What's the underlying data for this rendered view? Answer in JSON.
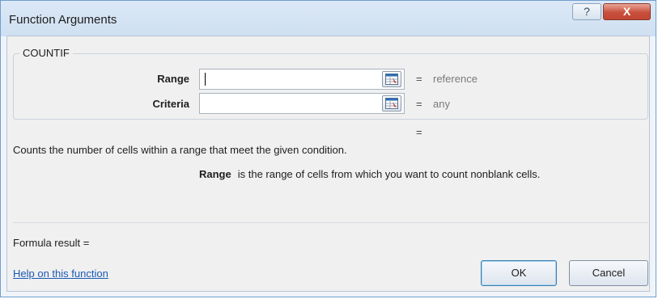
{
  "window": {
    "title": "Function Arguments",
    "help_label": "?",
    "close_label": "X"
  },
  "function": {
    "name": "COUNTIF",
    "arguments": [
      {
        "label": "Range",
        "value": "",
        "hint": "reference"
      },
      {
        "label": "Criteria",
        "value": "",
        "hint": "any"
      }
    ],
    "result_equals": "=",
    "description": "Counts the number of cells within a range that meet the given condition.",
    "arg_help_name": "Range",
    "arg_help_text": "is the range of cells from which you want to count nonblank cells."
  },
  "footer": {
    "formula_result": "Formula result =",
    "help_link": "Help on this function",
    "ok_label": "OK",
    "cancel_label": "Cancel"
  },
  "colors": {
    "link": "#1a5ab5",
    "close": "#c8503c",
    "titlebar": "#dbe8f6"
  }
}
